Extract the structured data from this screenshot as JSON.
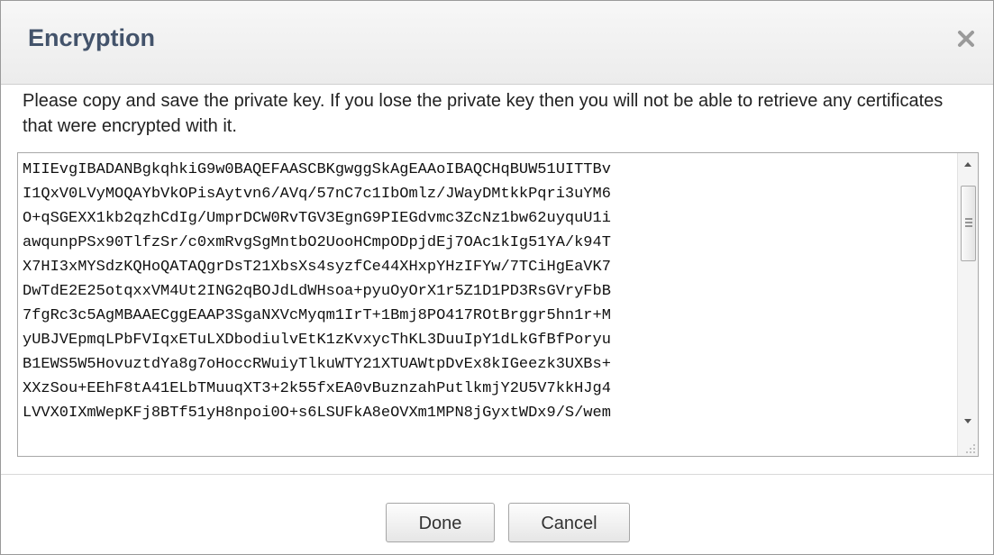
{
  "dialog": {
    "title": "Encryption",
    "close_icon": "close-x-icon",
    "message": "Please copy and save the private key. If you lose the private key then you will not be able to retrieve any certificates that were encrypted with it.",
    "private_key_lines": [
      "MIIEvgIBADANBgkqhkiG9w0BAQEFAASCBKgwggSkAgEAAoIBAQCHqBUW51UITTBv",
      "I1QxV0LVyMOQAYbVkOPisAytvn6/AVq/57nC7c1IbOmlz/JWayDMtkkPqri3uYM6",
      "O+qSGEXX1kb2qzhCdIg/UmprDCW0RvTGV3EgnG9PIEGdvmc3ZcNz1bw62uyquU1i",
      "awqunpPSx90TlfzSr/c0xmRvgSgMntbO2UooHCmpODpjdEj7OAc1kIg51YA/k94T",
      "X7HI3xMYSdzKQHoQATAQgrDsT21XbsXs4syzfCe44XHxpYHzIFYw/7TCiHgEaVK7",
      "DwTdE2E25otqxxVM4Ut2ING2qBOJdLdWHsoa+pyuOyOrX1r5Z1D1PD3RsGVryFbB",
      "7fgRc3c5AgMBAAECggEAAP3SgaNXVcMyqm1IrT+1Bmj8PO417ROtBrggr5hn1r+M",
      "yUBJVEpmqLPbFVIqxETuLXDbodiulvEtK1zKvxycThKL3DuuIpY1dLkGfBfPoryu",
      "B1EWS5W5HovuztdYa8g7oHoccRWuiyTlkuWTY21XTUAWtpDvEx8kIGeezk3UXBs+",
      "XXzSou+EEhF8tA41ELbTMuuqXT3+2k55fxEA0vBuznzahPutlkmjY2U5V7kkHJg4",
      "LVVX0IXmWepKFj8BTf51yH8npoi0O+s6LSUFkA8eOVXm1MPN8jGyxtWDx9/S/wem"
    ],
    "scroll_up_icon": "scroll-up-arrow-icon",
    "scroll_down_icon": "scroll-down-arrow-icon",
    "resize_icon": "resize-grip-icon",
    "buttons": {
      "done": "Done",
      "cancel": "Cancel"
    }
  }
}
